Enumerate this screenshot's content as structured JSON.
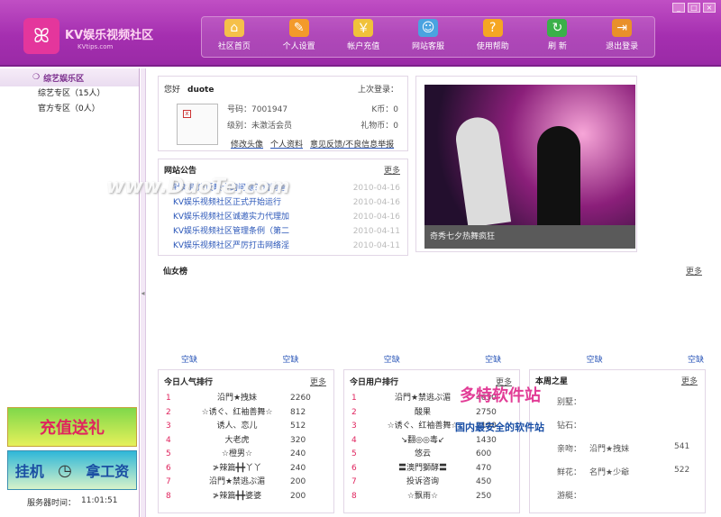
{
  "app": {
    "brand": "KV娱乐视频社区",
    "url": "KVtips.com"
  },
  "window_buttons": [
    "_",
    "□",
    "×"
  ],
  "toolbar": [
    {
      "label": "社区首页",
      "icon": "home-icon",
      "glyph": "⌂",
      "color": "#f5c04a"
    },
    {
      "label": "个人设置",
      "icon": "wrench-icon",
      "glyph": "✎",
      "color": "#f39a2b"
    },
    {
      "label": "帐户充值",
      "icon": "coins-icon",
      "glyph": "￥",
      "color": "#f0c23a"
    },
    {
      "label": "网站客服",
      "icon": "support-agent-icon",
      "glyph": "☺",
      "color": "#4aa3e0"
    },
    {
      "label": "使用帮助",
      "icon": "help-book-icon",
      "glyph": "?",
      "color": "#f5a623"
    },
    {
      "label": "刷 新",
      "icon": "refresh-icon",
      "glyph": "↻",
      "color": "#3bb04a"
    },
    {
      "label": "退出登录",
      "icon": "logout-door-icon",
      "glyph": "⇥",
      "color": "#e9902a"
    }
  ],
  "sidebar": {
    "header": "综艺娱乐区",
    "items": [
      {
        "label": "综艺专区（15人）"
      },
      {
        "label": "官方专区（0人）"
      }
    ],
    "promo1": "充值送礼",
    "promo2_left": "挂机",
    "promo2_right": "拿工资",
    "server_time_label": "服务器时间：",
    "server_time": "11:01:51"
  },
  "profile": {
    "hello": "您好",
    "username": "duote",
    "last_login_label": "上次登录：",
    "number_label": "号码：7001947",
    "kcoin_label": "K币：0",
    "level_label": "级别：未激活会员",
    "gift_label": "礼物币：0",
    "links": [
      "修改头像",
      "个人资料",
      "意见反馈/不良信息举报"
    ]
  },
  "notice": {
    "title": "网站公告",
    "more": "更多",
    "items": [
      {
        "title": "针对用户反映卡的问题？请同道",
        "date": "2010-04-16"
      },
      {
        "title": "KV娱乐视频社区正式开始运行",
        "date": "2010-04-16"
      },
      {
        "title": "KV娱乐视频社区诚邀实力代理加",
        "date": "2010-04-16"
      },
      {
        "title": "KV娱乐视频社区管理条例（第二",
        "date": "2010-04-11"
      },
      {
        "title": "KV娱乐视频社区严厉打击网络淫",
        "date": "2010-04-11"
      }
    ]
  },
  "banner": {
    "caption": "奇秀七夕热舞疯狂"
  },
  "fairy": {
    "title": "仙女榜",
    "more": "更多",
    "vacant": [
      "空缺",
      "空缺",
      "空缺",
      "空缺",
      "空缺",
      "空缺"
    ]
  },
  "today_popular": {
    "title": "今日人气排行",
    "more": "更多",
    "rows": [
      {
        "n": "1",
        "name": "沿門★拽妹",
        "v": "2260"
      },
      {
        "n": "2",
        "name": "☆诱ぐ、红袖善舞☆",
        "v": "812"
      },
      {
        "n": "3",
        "name": "诱人、恋儿",
        "v": "512"
      },
      {
        "n": "4",
        "name": "大老虎",
        "v": "320"
      },
      {
        "n": "5",
        "name": "☆橙男☆",
        "v": "240"
      },
      {
        "n": "6",
        "name": "≯辣篇╋╋丫丫",
        "v": "240"
      },
      {
        "n": "7",
        "name": "沿門★禁逃ぷ湄",
        "v": "200"
      },
      {
        "n": "8",
        "name": "≯辣篇╋╋婆婆",
        "v": "200"
      }
    ]
  },
  "today_user": {
    "title": "今日用户排行",
    "more": "更多",
    "rows": [
      {
        "n": "1",
        "name": "沿門★禁逃ぷ湄",
        "v": "4650"
      },
      {
        "n": "2",
        "name": "酸果",
        "v": "2750"
      },
      {
        "n": "3",
        "name": "☆诱ぐ、红袖善舞☆",
        "v": "2190"
      },
      {
        "n": "4",
        "name": "↘翻◎◎毒↙",
        "v": "1430"
      },
      {
        "n": "5",
        "name": "悠云",
        "v": "600"
      },
      {
        "n": "6",
        "name": "〓澳門獅酵〓",
        "v": "470"
      },
      {
        "n": "7",
        "name": "投诉咨询",
        "v": "450"
      },
      {
        "n": "8",
        "name": "☆飘雨☆",
        "v": "250"
      }
    ]
  },
  "week_star": {
    "title": "本周之星",
    "more": "更多",
    "rows": [
      {
        "k": "别墅：",
        "name": "",
        "v": ""
      },
      {
        "k": "钻石：",
        "name": "",
        "v": ""
      },
      {
        "k": "亲吻：",
        "name": "沿門★拽妹",
        "v": "541"
      },
      {
        "k": "鲜花：",
        "name": "名門★少爺",
        "v": "522"
      },
      {
        "k": "游艇：",
        "name": "",
        "v": ""
      }
    ]
  },
  "watermarks": {
    "main": "www.DuoTe.com",
    "site": "多特软件站",
    "slogan": "国内最安全的软件站"
  }
}
